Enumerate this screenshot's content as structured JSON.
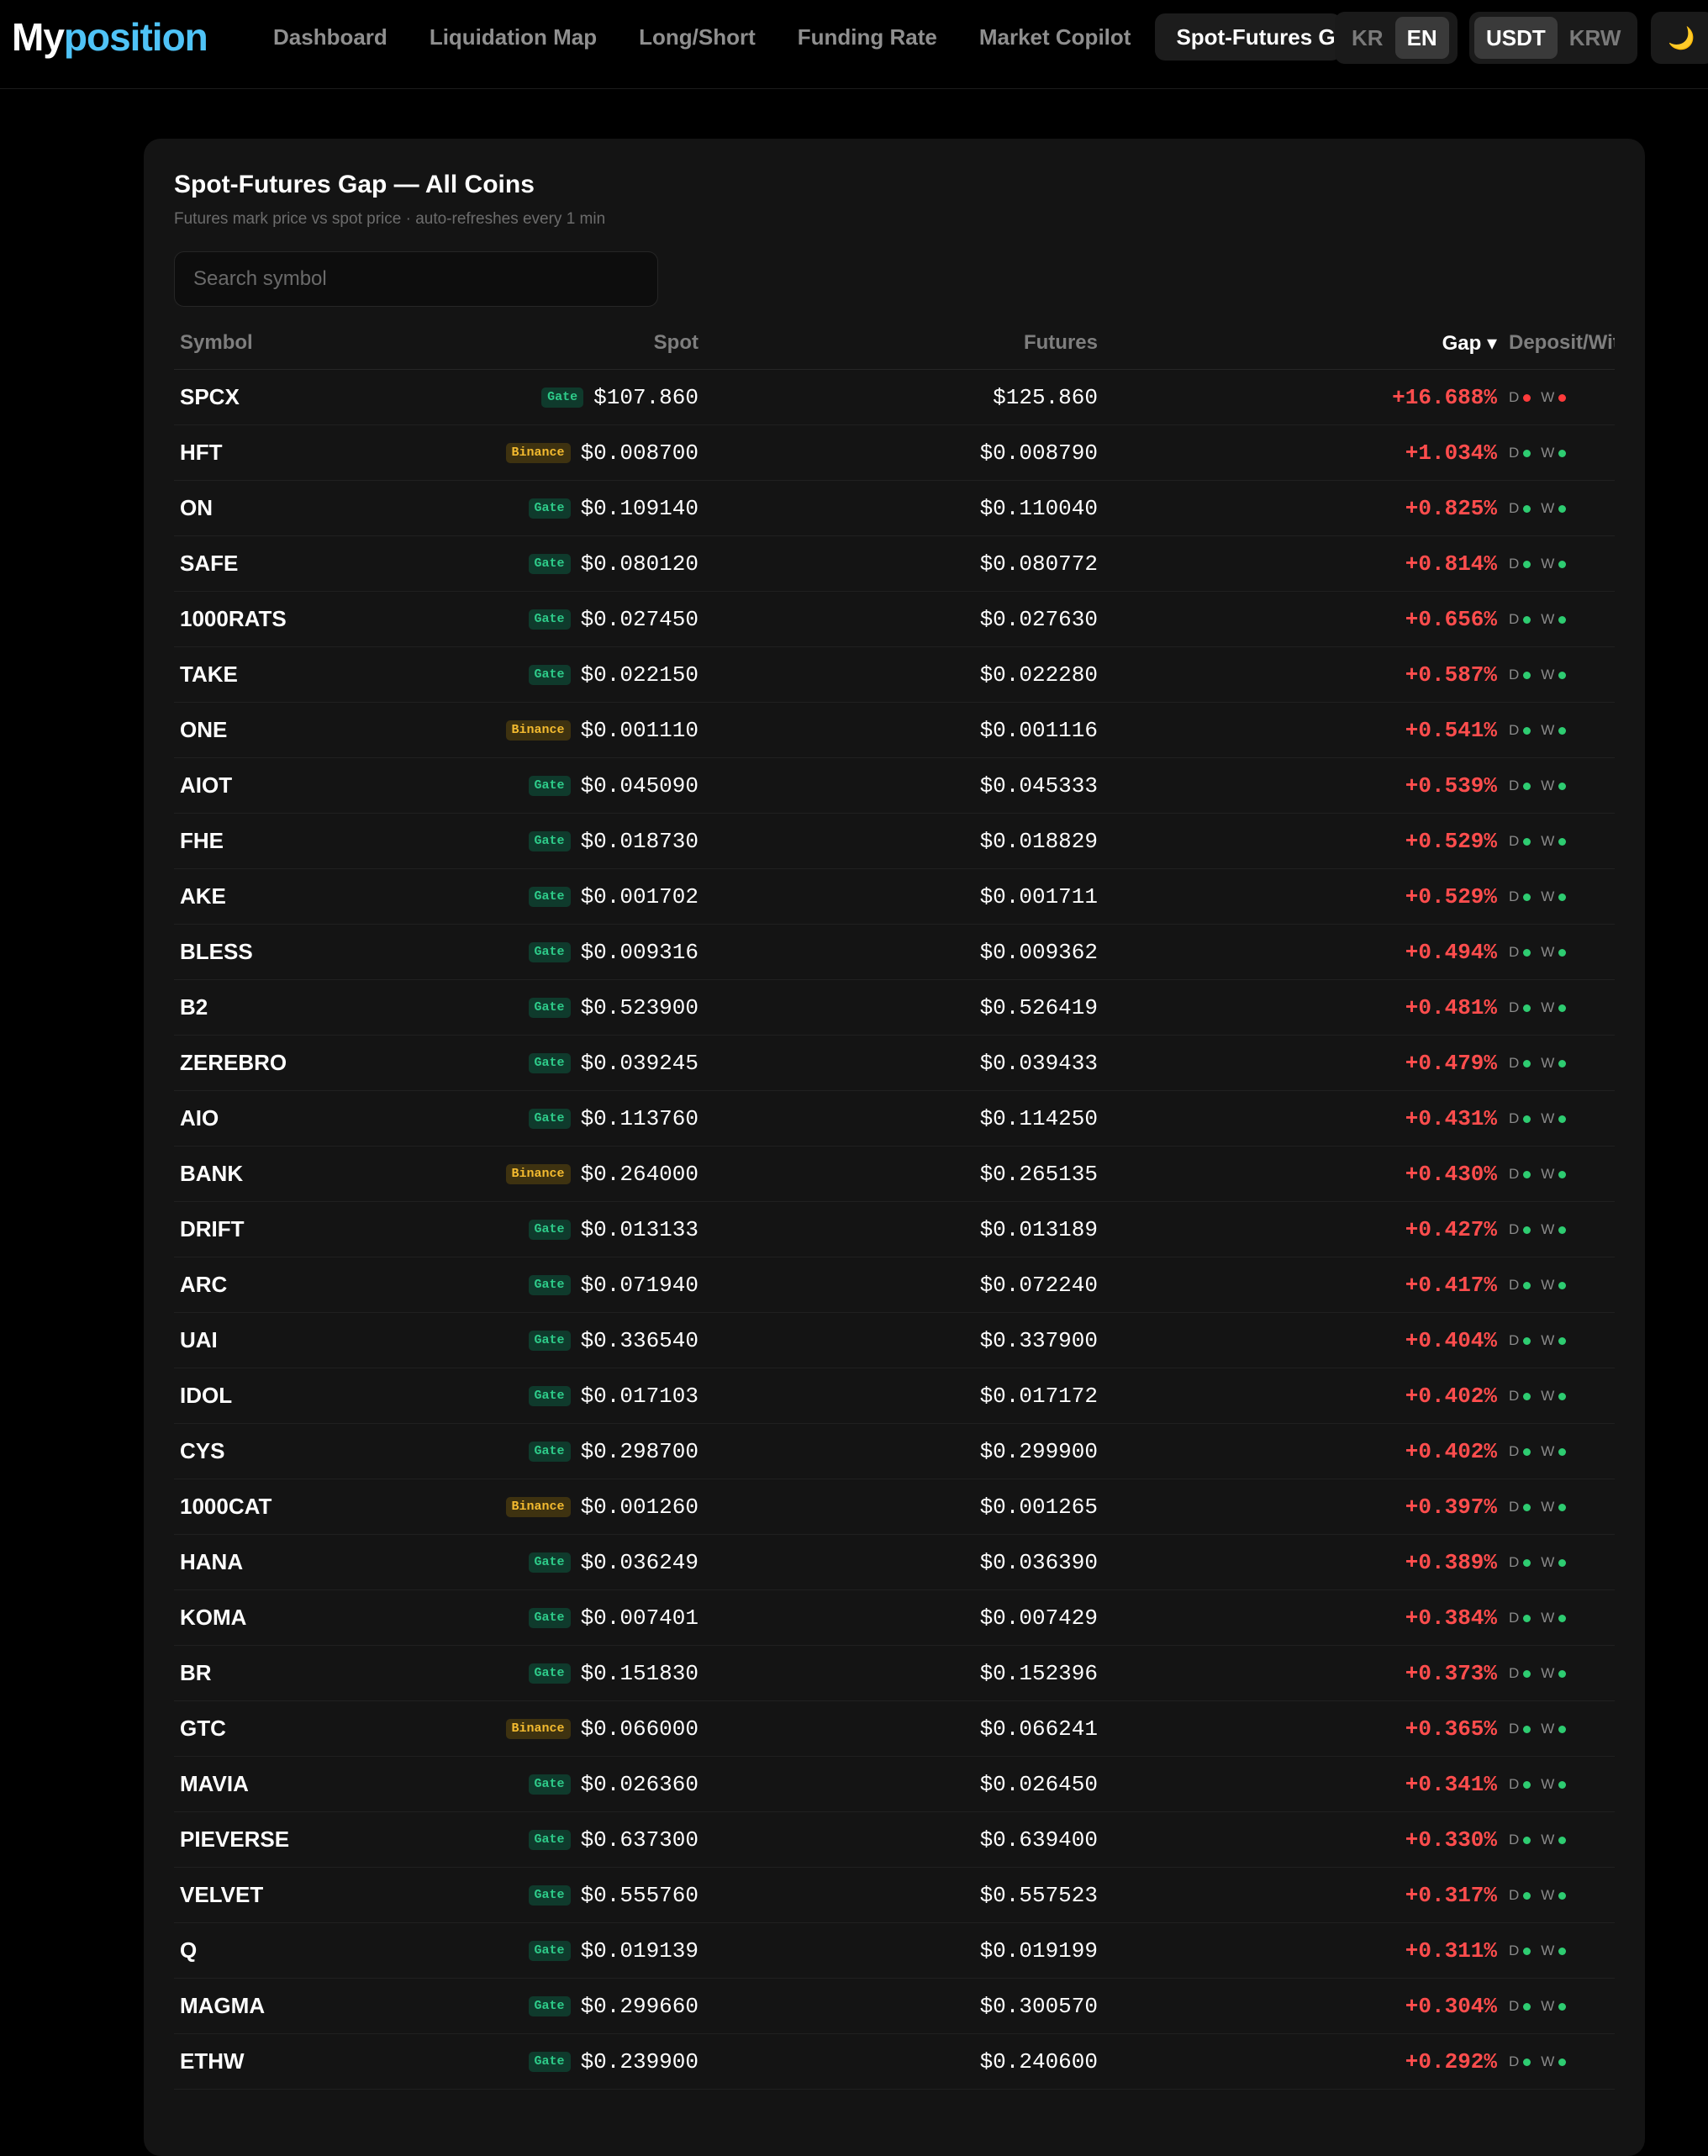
{
  "header": {
    "logo_part1": "My",
    "logo_part2": "position",
    "nav": [
      "Dashboard",
      "Liquidation Map",
      "Long/Short",
      "Funding Rate",
      "Market Copilot",
      "Spot-Futures Gap"
    ],
    "lang": [
      "KR",
      "EN"
    ],
    "currency": [
      "USDT",
      "KRW"
    ],
    "theme_icon": "🌙"
  },
  "card": {
    "title": "Spot-Futures Gap — All Coins",
    "subtitle": "Futures mark price vs spot price · auto-refreshes every 1 min",
    "search_placeholder": "Search symbol"
  },
  "table": {
    "headers": {
      "symbol": "Symbol",
      "spot": "Spot",
      "futures": "Futures",
      "gap": "Gap ▾",
      "dw": "Deposit/Withdraw"
    },
    "deposit_label": "D",
    "withdraw_label": "W",
    "rows": [
      {
        "symbol": "SPCX",
        "exchange": "Gate",
        "spot": "$107.860",
        "futures": "$125.860",
        "gap": "+16.688%",
        "deposit": "bad",
        "withdraw": "bad"
      },
      {
        "symbol": "HFT",
        "exchange": "Binance",
        "spot": "$0.008700",
        "futures": "$0.008790",
        "gap": "+1.034%",
        "deposit": "ok",
        "withdraw": "ok"
      },
      {
        "symbol": "ON",
        "exchange": "Gate",
        "spot": "$0.109140",
        "futures": "$0.110040",
        "gap": "+0.825%",
        "deposit": "ok",
        "withdraw": "ok"
      },
      {
        "symbol": "SAFE",
        "exchange": "Gate",
        "spot": "$0.080120",
        "futures": "$0.080772",
        "gap": "+0.814%",
        "deposit": "ok",
        "withdraw": "ok"
      },
      {
        "symbol": "1000RATS",
        "exchange": "Gate",
        "spot": "$0.027450",
        "futures": "$0.027630",
        "gap": "+0.656%",
        "deposit": "ok",
        "withdraw": "ok"
      },
      {
        "symbol": "TAKE",
        "exchange": "Gate",
        "spot": "$0.022150",
        "futures": "$0.022280",
        "gap": "+0.587%",
        "deposit": "ok",
        "withdraw": "ok"
      },
      {
        "symbol": "ONE",
        "exchange": "Binance",
        "spot": "$0.001110",
        "futures": "$0.001116",
        "gap": "+0.541%",
        "deposit": "ok",
        "withdraw": "ok"
      },
      {
        "symbol": "AIOT",
        "exchange": "Gate",
        "spot": "$0.045090",
        "futures": "$0.045333",
        "gap": "+0.539%",
        "deposit": "ok",
        "withdraw": "ok"
      },
      {
        "symbol": "FHE",
        "exchange": "Gate",
        "spot": "$0.018730",
        "futures": "$0.018829",
        "gap": "+0.529%",
        "deposit": "ok",
        "withdraw": "ok"
      },
      {
        "symbol": "AKE",
        "exchange": "Gate",
        "spot": "$0.001702",
        "futures": "$0.001711",
        "gap": "+0.529%",
        "deposit": "ok",
        "withdraw": "ok"
      },
      {
        "symbol": "BLESS",
        "exchange": "Gate",
        "spot": "$0.009316",
        "futures": "$0.009362",
        "gap": "+0.494%",
        "deposit": "ok",
        "withdraw": "ok"
      },
      {
        "symbol": "B2",
        "exchange": "Gate",
        "spot": "$0.523900",
        "futures": "$0.526419",
        "gap": "+0.481%",
        "deposit": "ok",
        "withdraw": "ok"
      },
      {
        "symbol": "ZEREBRO",
        "exchange": "Gate",
        "spot": "$0.039245",
        "futures": "$0.039433",
        "gap": "+0.479%",
        "deposit": "ok",
        "withdraw": "ok"
      },
      {
        "symbol": "AIO",
        "exchange": "Gate",
        "spot": "$0.113760",
        "futures": "$0.114250",
        "gap": "+0.431%",
        "deposit": "ok",
        "withdraw": "ok"
      },
      {
        "symbol": "BANK",
        "exchange": "Binance",
        "spot": "$0.264000",
        "futures": "$0.265135",
        "gap": "+0.430%",
        "deposit": "ok",
        "withdraw": "ok"
      },
      {
        "symbol": "DRIFT",
        "exchange": "Gate",
        "spot": "$0.013133",
        "futures": "$0.013189",
        "gap": "+0.427%",
        "deposit": "ok",
        "withdraw": "ok"
      },
      {
        "symbol": "ARC",
        "exchange": "Gate",
        "spot": "$0.071940",
        "futures": "$0.072240",
        "gap": "+0.417%",
        "deposit": "ok",
        "withdraw": "ok"
      },
      {
        "symbol": "UAI",
        "exchange": "Gate",
        "spot": "$0.336540",
        "futures": "$0.337900",
        "gap": "+0.404%",
        "deposit": "ok",
        "withdraw": "ok"
      },
      {
        "symbol": "IDOL",
        "exchange": "Gate",
        "spot": "$0.017103",
        "futures": "$0.017172",
        "gap": "+0.402%",
        "deposit": "ok",
        "withdraw": "ok"
      },
      {
        "symbol": "CYS",
        "exchange": "Gate",
        "spot": "$0.298700",
        "futures": "$0.299900",
        "gap": "+0.402%",
        "deposit": "ok",
        "withdraw": "ok"
      },
      {
        "symbol": "1000CAT",
        "exchange": "Binance",
        "spot": "$0.001260",
        "futures": "$0.001265",
        "gap": "+0.397%",
        "deposit": "ok",
        "withdraw": "ok"
      },
      {
        "symbol": "HANA",
        "exchange": "Gate",
        "spot": "$0.036249",
        "futures": "$0.036390",
        "gap": "+0.389%",
        "deposit": "ok",
        "withdraw": "ok"
      },
      {
        "symbol": "KOMA",
        "exchange": "Gate",
        "spot": "$0.007401",
        "futures": "$0.007429",
        "gap": "+0.384%",
        "deposit": "ok",
        "withdraw": "ok"
      },
      {
        "symbol": "BR",
        "exchange": "Gate",
        "spot": "$0.151830",
        "futures": "$0.152396",
        "gap": "+0.373%",
        "deposit": "ok",
        "withdraw": "ok"
      },
      {
        "symbol": "GTC",
        "exchange": "Binance",
        "spot": "$0.066000",
        "futures": "$0.066241",
        "gap": "+0.365%",
        "deposit": "ok",
        "withdraw": "ok"
      },
      {
        "symbol": "MAVIA",
        "exchange": "Gate",
        "spot": "$0.026360",
        "futures": "$0.026450",
        "gap": "+0.341%",
        "deposit": "ok",
        "withdraw": "ok"
      },
      {
        "symbol": "PIEVERSE",
        "exchange": "Gate",
        "spot": "$0.637300",
        "futures": "$0.639400",
        "gap": "+0.330%",
        "deposit": "ok",
        "withdraw": "ok"
      },
      {
        "symbol": "VELVET",
        "exchange": "Gate",
        "spot": "$0.555760",
        "futures": "$0.557523",
        "gap": "+0.317%",
        "deposit": "ok",
        "withdraw": "ok"
      },
      {
        "symbol": "Q",
        "exchange": "Gate",
        "spot": "$0.019139",
        "futures": "$0.019199",
        "gap": "+0.311%",
        "deposit": "ok",
        "withdraw": "ok"
      },
      {
        "symbol": "MAGMA",
        "exchange": "Gate",
        "spot": "$0.299660",
        "futures": "$0.300570",
        "gap": "+0.304%",
        "deposit": "ok",
        "withdraw": "ok"
      },
      {
        "symbol": "ETHW",
        "exchange": "Gate",
        "spot": "$0.239900",
        "futures": "$0.240600",
        "gap": "+0.292%",
        "deposit": "ok",
        "withdraw": "ok"
      }
    ]
  },
  "colors": {
    "accent": "#4fc3f7",
    "gap_positive": "#ff4d4d",
    "status_ok": "#2ecc71",
    "status_bad": "#ff3b3b"
  }
}
